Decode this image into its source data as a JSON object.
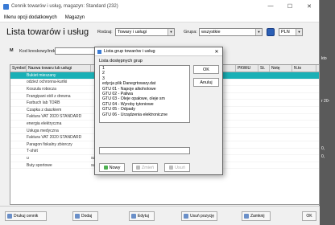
{
  "window": {
    "title": "Cennik towarów i usług, magazyn: Standard (232)"
  },
  "menu": [
    "Menu opcji dodatkowych",
    "Magazyn"
  ],
  "page": {
    "title": "Lista towarów i usług"
  },
  "filters": {
    "rodzaj_label": "Rodzaj:",
    "rodzaj_value": "Towary i usługi",
    "grupa_label": "Grupa:",
    "grupa_value": "wszystkie",
    "currency": "PLN"
  },
  "search": {
    "label": "Kod kreskowy/indeks"
  },
  "grid": {
    "headers": [
      "Symbol",
      "Nazwa towaru lub usługi",
      "",
      "",
      "PKWiU",
      "St.",
      "Notę",
      "N.to"
    ],
    "rows": [
      {
        "name": "Bukiet mieszany",
        "c1": "",
        "c2": "",
        "c3": "",
        "sel": true
      },
      {
        "name": "odzież ochronna-kurtki",
        "c1": "",
        "c2": "",
        "c3": ""
      },
      {
        "name": "Koszula robocza",
        "c1": "",
        "c2": "",
        "c3": ""
      },
      {
        "name": "Frangipani stół z drewna",
        "c1": "",
        "c2": "",
        "c3": ""
      },
      {
        "name": "Farbuch lab TORB",
        "c1": "",
        "c2": "",
        "c3": ""
      },
      {
        "name": "Czapka z daszkiem",
        "c1": "",
        "c2": "",
        "c3": ""
      },
      {
        "name": "Faktura VAT 2020 STANDARD",
        "c1": "",
        "c2": "",
        "c3": ""
      },
      {
        "name": "energia elektryczna",
        "c1": "",
        "c2": "",
        "c3": ""
      },
      {
        "name": "Usługa medyczna",
        "c1": "",
        "c2": "",
        "c3": ""
      },
      {
        "name": "Faktura VAT 2020 STANDARD",
        "c1": "",
        "c2": "",
        "c3": ""
      },
      {
        "name": "Paragon fiskalny zbiorczy",
        "c1": "",
        "c2": "",
        "c3": ""
      },
      {
        "name": "T-shirt",
        "c1": "",
        "c2": "",
        "c3": ""
      },
      {
        "name": "u",
        "c1": "szt",
        "c2": "23%",
        "c3": "100,00"
      },
      {
        "name": "Buty sportowe",
        "c1": "szt",
        "c2": "23%",
        "c3": "123,00"
      }
    ]
  },
  "dialog": {
    "title": "Lista grup towarów i usług",
    "subtitle": "Lista dostępnych grup",
    "items": [
      "1",
      "2",
      "3",
      "edycja plik Danegrtowary.dat",
      "GTU 01 - Napoje alkoholowe",
      "GTU 02 - Paliwa",
      "GTU 03 - Oleje opałowe, oleje sm",
      "GTU 04 - Wyroby tytoniowe",
      "GTU 05 - Odpady",
      "GTU 06 - Urządzenia elektroniczne"
    ],
    "ok": "OK",
    "cancel": "Anuluj",
    "new": "Nowy",
    "change": "Zmień",
    "delete": "Usuń"
  },
  "bottom": [
    "Drukuj cennik",
    "Dodaj",
    "Edytuj",
    "Usuń pozycję",
    "Zamknij"
  ],
  "right_panel": [
    "kto",
    "r 20-",
    "0,",
    "0,"
  ]
}
